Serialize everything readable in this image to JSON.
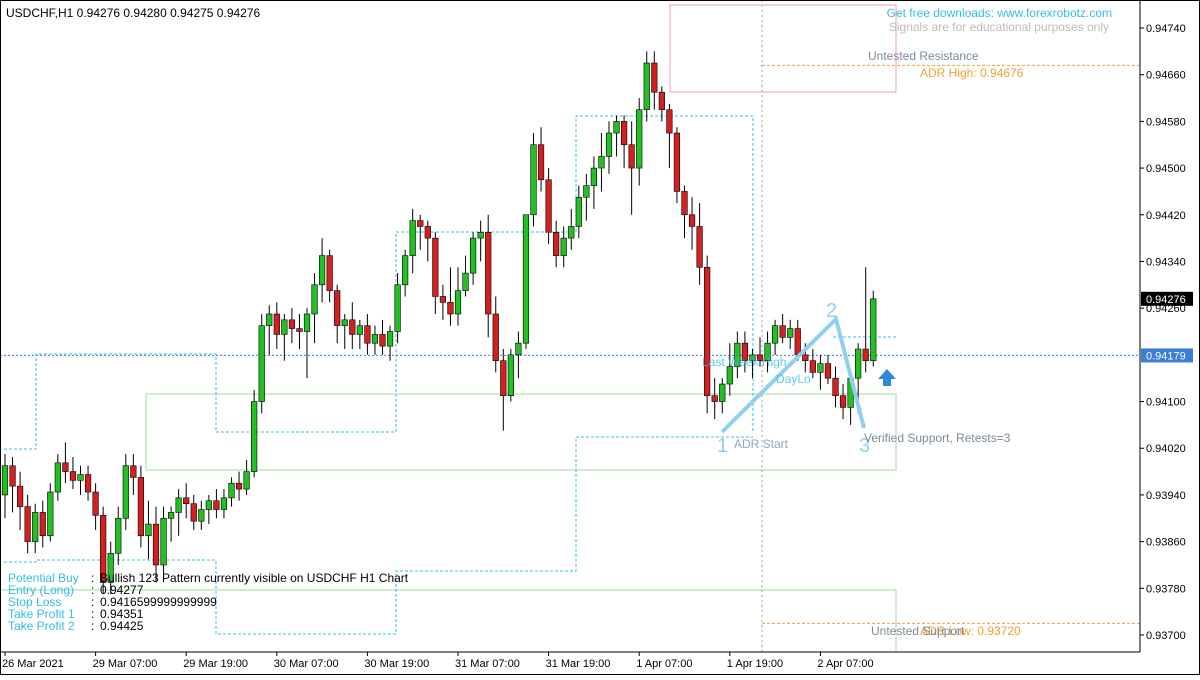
{
  "header": {
    "symbol_line": "USDCHF,H1  0.94276 0.94280 0.94275 0.94276"
  },
  "credits": {
    "line1": "Get free downloads: www.forexrobotz.com",
    "line2": "Signals are for educational purposes only"
  },
  "labels": {
    "untested_resistance": "Untested Resistance",
    "adr_high": "ADR High: 0.94676",
    "last_week_high": "Last Week High",
    "day_lo": "DayLo",
    "adr_start": "ADR Start",
    "verified_support": "Verified Support, Retests=3",
    "untested_support": "Untested Support",
    "adr_low": "ADR Low: 0.93720",
    "point_1": "1",
    "point_2": "2",
    "point_3": "3",
    "up_arrow": "up-arrow-icon"
  },
  "info": {
    "rows": [
      {
        "label": "Potential Buy",
        "value": "Bullish 123 Pattern currently visible on USDCHF H1 Chart"
      },
      {
        "label": "Entry (Long)",
        "value": "0.94277"
      },
      {
        "label": "Stop Loss",
        "value": "0.9416599999999999"
      },
      {
        "label": "Take Profit 1",
        "value": "0.94351"
      },
      {
        "label": "Take Profit 2",
        "value": "0.94425"
      }
    ]
  },
  "price_tags": {
    "current": "0.94276",
    "line": "0.94179"
  },
  "colors": {
    "bull": "#22c022",
    "bear": "#d42020",
    "cyan": "#33bde6",
    "orange": "#f0a030",
    "pattern": "#8fd0f0",
    "zone_green": "#9cdc9c",
    "zone_pink": "#f0a0a8"
  },
  "chart_data": {
    "type": "candlestick",
    "symbol": "USDCHF",
    "timeframe": "H1",
    "ylim": [
      0.9368,
      0.9476
    ],
    "y_ticks": [
      "0.94740",
      "0.94660",
      "0.94580",
      "0.94500",
      "0.94420",
      "0.94340",
      "0.94260",
      "0.94179",
      "0.94100",
      "0.94020",
      "0.93940",
      "0.93860",
      "0.93780",
      "0.93700"
    ],
    "x_ticks": [
      "26 Mar 2021",
      "29 Mar 07:00",
      "29 Mar 19:00",
      "30 Mar 07:00",
      "30 Mar 19:00",
      "31 Mar 07:00",
      "31 Mar 19:00",
      "1 Apr 07:00",
      "1 Apr 19:00",
      "2 Apr 07:00"
    ],
    "x_tick_bars": [
      0,
      12,
      24,
      36,
      48,
      60,
      72,
      84,
      96,
      108
    ],
    "current_price": 0.94276,
    "horizontal_line": 0.94179,
    "adr_high": 0.94676,
    "adr_low": 0.9372,
    "bars": [
      {
        "o": 0.9394,
        "h": 0.9401,
        "l": 0.939,
        "c": 0.9399
      },
      {
        "o": 0.9399,
        "h": 0.94005,
        "l": 0.9391,
        "c": 0.93955
      },
      {
        "o": 0.93955,
        "h": 0.9398,
        "l": 0.9388,
        "c": 0.9392
      },
      {
        "o": 0.9392,
        "h": 0.9394,
        "l": 0.9384,
        "c": 0.9386
      },
      {
        "o": 0.9386,
        "h": 0.93925,
        "l": 0.9384,
        "c": 0.9391
      },
      {
        "o": 0.9391,
        "h": 0.9393,
        "l": 0.9385,
        "c": 0.9387
      },
      {
        "o": 0.9387,
        "h": 0.9396,
        "l": 0.9386,
        "c": 0.93945
      },
      {
        "o": 0.93945,
        "h": 0.9401,
        "l": 0.9393,
        "c": 0.93995
      },
      {
        "o": 0.93995,
        "h": 0.9403,
        "l": 0.9396,
        "c": 0.9398
      },
      {
        "o": 0.9398,
        "h": 0.94005,
        "l": 0.9395,
        "c": 0.93965
      },
      {
        "o": 0.93965,
        "h": 0.9399,
        "l": 0.9394,
        "c": 0.93975
      },
      {
        "o": 0.93975,
        "h": 0.9399,
        "l": 0.9393,
        "c": 0.93945
      },
      {
        "o": 0.93945,
        "h": 0.9396,
        "l": 0.9388,
        "c": 0.93905
      },
      {
        "o": 0.93905,
        "h": 0.9392,
        "l": 0.9377,
        "c": 0.9379
      },
      {
        "o": 0.9379,
        "h": 0.9386,
        "l": 0.9377,
        "c": 0.9384
      },
      {
        "o": 0.9384,
        "h": 0.9392,
        "l": 0.9382,
        "c": 0.939
      },
      {
        "o": 0.939,
        "h": 0.9401,
        "l": 0.9388,
        "c": 0.9399
      },
      {
        "o": 0.9399,
        "h": 0.9401,
        "l": 0.9394,
        "c": 0.9397
      },
      {
        "o": 0.9397,
        "h": 0.9399,
        "l": 0.9385,
        "c": 0.9387
      },
      {
        "o": 0.9387,
        "h": 0.9393,
        "l": 0.9383,
        "c": 0.9389
      },
      {
        "o": 0.9389,
        "h": 0.9392,
        "l": 0.9379,
        "c": 0.9382
      },
      {
        "o": 0.9382,
        "h": 0.9392,
        "l": 0.938,
        "c": 0.939
      },
      {
        "o": 0.939,
        "h": 0.9392,
        "l": 0.9386,
        "c": 0.9391
      },
      {
        "o": 0.9391,
        "h": 0.9395,
        "l": 0.9387,
        "c": 0.93935
      },
      {
        "o": 0.93935,
        "h": 0.9396,
        "l": 0.939,
        "c": 0.93925
      },
      {
        "o": 0.93925,
        "h": 0.9394,
        "l": 0.9388,
        "c": 0.93895
      },
      {
        "o": 0.93895,
        "h": 0.9393,
        "l": 0.9388,
        "c": 0.93915
      },
      {
        "o": 0.93915,
        "h": 0.9394,
        "l": 0.9389,
        "c": 0.9393
      },
      {
        "o": 0.9393,
        "h": 0.9395,
        "l": 0.939,
        "c": 0.93915
      },
      {
        "o": 0.93915,
        "h": 0.9395,
        "l": 0.939,
        "c": 0.93935
      },
      {
        "o": 0.93935,
        "h": 0.9397,
        "l": 0.9392,
        "c": 0.9396
      },
      {
        "o": 0.9396,
        "h": 0.9398,
        "l": 0.9393,
        "c": 0.9395
      },
      {
        "o": 0.9395,
        "h": 0.94,
        "l": 0.9394,
        "c": 0.9398
      },
      {
        "o": 0.9398,
        "h": 0.9412,
        "l": 0.9397,
        "c": 0.941
      },
      {
        "o": 0.941,
        "h": 0.9425,
        "l": 0.9408,
        "c": 0.9423
      },
      {
        "o": 0.9423,
        "h": 0.94265,
        "l": 0.9418,
        "c": 0.9425
      },
      {
        "o": 0.9425,
        "h": 0.9427,
        "l": 0.9419,
        "c": 0.94215
      },
      {
        "o": 0.94215,
        "h": 0.9425,
        "l": 0.9417,
        "c": 0.9424
      },
      {
        "o": 0.9424,
        "h": 0.9426,
        "l": 0.942,
        "c": 0.94225
      },
      {
        "o": 0.94225,
        "h": 0.9425,
        "l": 0.9419,
        "c": 0.9422
      },
      {
        "o": 0.9422,
        "h": 0.9426,
        "l": 0.9414,
        "c": 0.9425
      },
      {
        "o": 0.9425,
        "h": 0.9432,
        "l": 0.942,
        "c": 0.943
      },
      {
        "o": 0.943,
        "h": 0.9438,
        "l": 0.9427,
        "c": 0.9435
      },
      {
        "o": 0.9435,
        "h": 0.9436,
        "l": 0.9427,
        "c": 0.9429
      },
      {
        "o": 0.9429,
        "h": 0.943,
        "l": 0.942,
        "c": 0.9423
      },
      {
        "o": 0.9423,
        "h": 0.9425,
        "l": 0.9419,
        "c": 0.9424
      },
      {
        "o": 0.9424,
        "h": 0.9427,
        "l": 0.9419,
        "c": 0.94215
      },
      {
        "o": 0.94215,
        "h": 0.9424,
        "l": 0.9419,
        "c": 0.9423
      },
      {
        "o": 0.9423,
        "h": 0.9425,
        "l": 0.9418,
        "c": 0.942
      },
      {
        "o": 0.942,
        "h": 0.9423,
        "l": 0.9418,
        "c": 0.94215
      },
      {
        "o": 0.94215,
        "h": 0.9424,
        "l": 0.9418,
        "c": 0.94195
      },
      {
        "o": 0.94195,
        "h": 0.9423,
        "l": 0.9417,
        "c": 0.9422
      },
      {
        "o": 0.9422,
        "h": 0.9432,
        "l": 0.942,
        "c": 0.943
      },
      {
        "o": 0.943,
        "h": 0.9436,
        "l": 0.9428,
        "c": 0.9435
      },
      {
        "o": 0.9435,
        "h": 0.9443,
        "l": 0.9432,
        "c": 0.9441
      },
      {
        "o": 0.9441,
        "h": 0.9442,
        "l": 0.9436,
        "c": 0.944
      },
      {
        "o": 0.944,
        "h": 0.9441,
        "l": 0.9434,
        "c": 0.9438
      },
      {
        "o": 0.9438,
        "h": 0.9439,
        "l": 0.9425,
        "c": 0.9428
      },
      {
        "o": 0.9428,
        "h": 0.943,
        "l": 0.9424,
        "c": 0.9427
      },
      {
        "o": 0.9427,
        "h": 0.9433,
        "l": 0.9423,
        "c": 0.9425
      },
      {
        "o": 0.9425,
        "h": 0.9433,
        "l": 0.9423,
        "c": 0.9429
      },
      {
        "o": 0.9429,
        "h": 0.9435,
        "l": 0.9428,
        "c": 0.9432
      },
      {
        "o": 0.9432,
        "h": 0.9439,
        "l": 0.943,
        "c": 0.9438
      },
      {
        "o": 0.9438,
        "h": 0.9441,
        "l": 0.9434,
        "c": 0.9439
      },
      {
        "o": 0.9439,
        "h": 0.9442,
        "l": 0.9421,
        "c": 0.9425
      },
      {
        "o": 0.9425,
        "h": 0.9428,
        "l": 0.9415,
        "c": 0.9417
      },
      {
        "o": 0.9417,
        "h": 0.9419,
        "l": 0.9405,
        "c": 0.9411
      },
      {
        "o": 0.9411,
        "h": 0.9419,
        "l": 0.941,
        "c": 0.9418
      },
      {
        "o": 0.9418,
        "h": 0.9422,
        "l": 0.9414,
        "c": 0.942
      },
      {
        "o": 0.942,
        "h": 0.9442,
        "l": 0.9419,
        "c": 0.9442
      },
      {
        "o": 0.9442,
        "h": 0.9456,
        "l": 0.944,
        "c": 0.9454
      },
      {
        "o": 0.9454,
        "h": 0.9457,
        "l": 0.9446,
        "c": 0.9448
      },
      {
        "o": 0.9448,
        "h": 0.945,
        "l": 0.9437,
        "c": 0.9439
      },
      {
        "o": 0.9439,
        "h": 0.9441,
        "l": 0.9433,
        "c": 0.9435
      },
      {
        "o": 0.9435,
        "h": 0.944,
        "l": 0.9433,
        "c": 0.9438
      },
      {
        "o": 0.9438,
        "h": 0.9443,
        "l": 0.9436,
        "c": 0.944
      },
      {
        "o": 0.944,
        "h": 0.9447,
        "l": 0.9438,
        "c": 0.9445
      },
      {
        "o": 0.9445,
        "h": 0.9449,
        "l": 0.9441,
        "c": 0.9447
      },
      {
        "o": 0.9447,
        "h": 0.9452,
        "l": 0.9443,
        "c": 0.945
      },
      {
        "o": 0.945,
        "h": 0.9456,
        "l": 0.9446,
        "c": 0.9452
      },
      {
        "o": 0.9452,
        "h": 0.9458,
        "l": 0.9449,
        "c": 0.9456
      },
      {
        "o": 0.9456,
        "h": 0.9459,
        "l": 0.9452,
        "c": 0.9458
      },
      {
        "o": 0.9458,
        "h": 0.9459,
        "l": 0.945,
        "c": 0.9454
      },
      {
        "o": 0.9454,
        "h": 0.9458,
        "l": 0.9442,
        "c": 0.945
      },
      {
        "o": 0.945,
        "h": 0.9462,
        "l": 0.9447,
        "c": 0.946
      },
      {
        "o": 0.946,
        "h": 0.947,
        "l": 0.9458,
        "c": 0.9468
      },
      {
        "o": 0.9468,
        "h": 0.947,
        "l": 0.946,
        "c": 0.9463
      },
      {
        "o": 0.9463,
        "h": 0.9464,
        "l": 0.9458,
        "c": 0.946
      },
      {
        "o": 0.946,
        "h": 0.9461,
        "l": 0.945,
        "c": 0.9456
      },
      {
        "o": 0.9456,
        "h": 0.9457,
        "l": 0.9444,
        "c": 0.9446
      },
      {
        "o": 0.9446,
        "h": 0.9447,
        "l": 0.9438,
        "c": 0.9442
      },
      {
        "o": 0.9442,
        "h": 0.9445,
        "l": 0.9436,
        "c": 0.944
      },
      {
        "o": 0.944,
        "h": 0.9444,
        "l": 0.943,
        "c": 0.9433
      },
      {
        "o": 0.9433,
        "h": 0.9435,
        "l": 0.9408,
        "c": 0.9411
      },
      {
        "o": 0.9411,
        "h": 0.9414,
        "l": 0.9407,
        "c": 0.941
      },
      {
        "o": 0.941,
        "h": 0.9414,
        "l": 0.9408,
        "c": 0.9413
      },
      {
        "o": 0.9413,
        "h": 0.942,
        "l": 0.9411,
        "c": 0.9416
      },
      {
        "o": 0.9416,
        "h": 0.9422,
        "l": 0.9414,
        "c": 0.942
      },
      {
        "o": 0.942,
        "h": 0.9422,
        "l": 0.9415,
        "c": 0.9417
      },
      {
        "o": 0.9417,
        "h": 0.9419,
        "l": 0.9414,
        "c": 0.9418
      },
      {
        "o": 0.9418,
        "h": 0.9421,
        "l": 0.9416,
        "c": 0.9417
      },
      {
        "o": 0.9417,
        "h": 0.9422,
        "l": 0.9415,
        "c": 0.942
      },
      {
        "o": 0.942,
        "h": 0.9424,
        "l": 0.9418,
        "c": 0.9423
      },
      {
        "o": 0.9423,
        "h": 0.9425,
        "l": 0.942,
        "c": 0.9421
      },
      {
        "o": 0.9421,
        "h": 0.9424,
        "l": 0.9419,
        "c": 0.94225
      },
      {
        "o": 0.94225,
        "h": 0.9424,
        "l": 0.9417,
        "c": 0.9418
      },
      {
        "o": 0.9418,
        "h": 0.942,
        "l": 0.9415,
        "c": 0.9417
      },
      {
        "o": 0.9417,
        "h": 0.9419,
        "l": 0.9414,
        "c": 0.9415
      },
      {
        "o": 0.9415,
        "h": 0.9418,
        "l": 0.9412,
        "c": 0.94165
      },
      {
        "o": 0.94165,
        "h": 0.9418,
        "l": 0.9413,
        "c": 0.9414
      },
      {
        "o": 0.9414,
        "h": 0.9416,
        "l": 0.9409,
        "c": 0.9411
      },
      {
        "o": 0.9411,
        "h": 0.9413,
        "l": 0.9407,
        "c": 0.9409
      },
      {
        "o": 0.9409,
        "h": 0.9415,
        "l": 0.9406,
        "c": 0.9414
      },
      {
        "o": 0.9414,
        "h": 0.942,
        "l": 0.9408,
        "c": 0.9419
      },
      {
        "o": 0.9419,
        "h": 0.9433,
        "l": 0.9415,
        "c": 0.9417
      },
      {
        "o": 0.9417,
        "h": 0.9429,
        "l": 0.9416,
        "c": 0.94276
      }
    ]
  }
}
